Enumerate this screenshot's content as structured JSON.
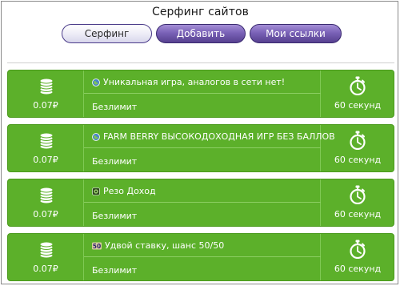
{
  "page": {
    "title": "Серфинг сайтов"
  },
  "nav": {
    "surfing": "Серфинг",
    "add": "Добавить",
    "my_links": "Мои ссылки"
  },
  "tasks": [
    {
      "price": "0.07₽",
      "icon": "globe-icon",
      "title": "Уникальная игра, аналогов в сети нет!",
      "limit": "Безлимит",
      "duration": "60 секунд"
    },
    {
      "price": "0.07₽",
      "icon": "globe-icon",
      "title": "FARM BERRY ВЫСОКОДОХОДНАЯ ИГР БЕЗ БАЛЛОВ",
      "limit": "Безлимит",
      "duration": "60 секунд"
    },
    {
      "price": "0.07₽",
      "icon": "site-logo-icon",
      "title": "Резо Доход",
      "limit": "Безлимит",
      "duration": "60 секунд"
    },
    {
      "price": "0.07₽",
      "icon": "fifty-badge-icon",
      "badge_text": "50",
      "title": "Удвой ставку, шанс 50/50",
      "limit": "Безлимит",
      "duration": "60 секунд"
    }
  ],
  "colors": {
    "card_green": "#5cb02a",
    "nav_purple": "#7a62b7",
    "badge_purple": "#2a1a6e"
  }
}
